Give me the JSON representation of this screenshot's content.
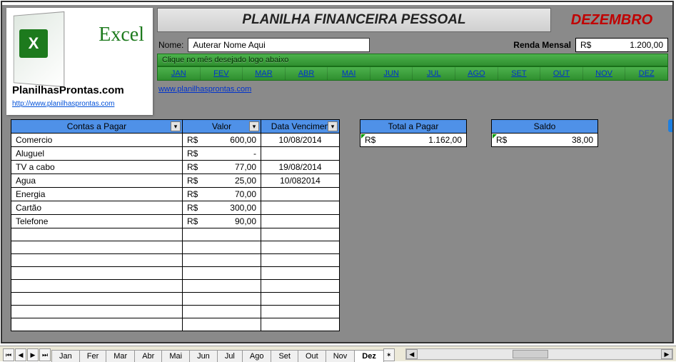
{
  "logo": {
    "excel_text": "Excel",
    "brand": "PlanilhasProntas.com",
    "brand_url": "http://www.planilhasprontas.com"
  },
  "header": {
    "title": "PLANILHA FINANCEIRA PESSOAL",
    "month": "DEZEMBRO",
    "nome_label": "Nome:",
    "nome_value": "Auterar Nome Aqui",
    "renda_label": "Renda Mensal",
    "renda_cur": "R$",
    "renda_value": "1.200,00",
    "instruction": "Clique no mês desejado logo abaixo",
    "site_link": "www.planilhasprontas.com"
  },
  "months": [
    "JAN",
    "FEV",
    "MAR",
    "ABR",
    "MAI",
    "JUN",
    "JUL",
    "AGO",
    "SET",
    "OUT",
    "NOV",
    "DEZ"
  ],
  "table": {
    "h_contas": "Contas a Pagar",
    "h_valor": "Valor",
    "h_data": "Data Vencimen",
    "rows": [
      {
        "c": "Comercio",
        "cur": "R$",
        "v": "600,00",
        "d": "10/08/2014"
      },
      {
        "c": "Aluguel",
        "cur": "R$",
        "v": "-",
        "d": ""
      },
      {
        "c": "TV a cabo",
        "cur": "R$",
        "v": "77,00",
        "d": "19/08/2014"
      },
      {
        "c": "Agua",
        "cur": "R$",
        "v": "25,00",
        "d": "10/082014"
      },
      {
        "c": "Energia",
        "cur": "R$",
        "v": "70,00",
        "d": ""
      },
      {
        "c": "Cartão",
        "cur": "R$",
        "v": "300,00",
        "d": ""
      },
      {
        "c": "Telefone",
        "cur": "R$",
        "v": "90,00",
        "d": ""
      }
    ],
    "empty_rows": 8
  },
  "summary": {
    "total_label": "Total a Pagar",
    "total_cur": "R$",
    "total_val": "1.162,00",
    "saldo_label": "Saldo",
    "saldo_cur": "R$",
    "saldo_val": "38,00"
  },
  "tabs": [
    "Jan",
    "Fer",
    "Mar",
    "Abr",
    "Mai",
    "Jun",
    "Jul",
    "Ago",
    "Set",
    "Out",
    "Nov",
    "Dez"
  ],
  "active_tab": "Dez"
}
